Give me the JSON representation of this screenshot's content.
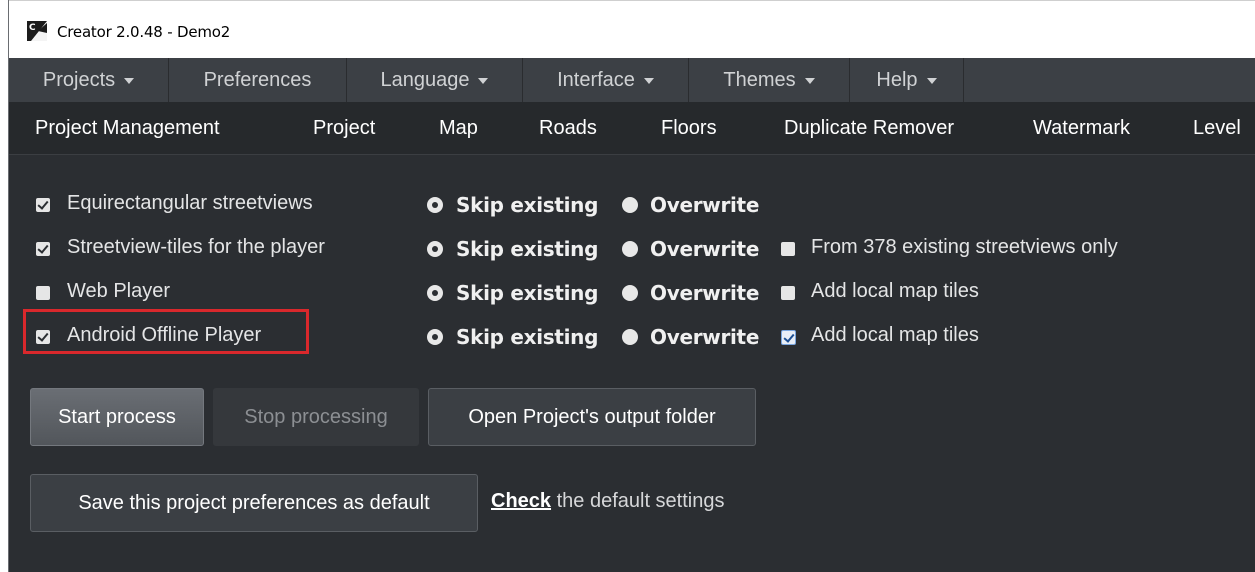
{
  "window": {
    "title": "Creator 2.0.48 - Demo2"
  },
  "menu": {
    "items": [
      {
        "label": "Projects",
        "dropdown": true
      },
      {
        "label": "Preferences",
        "dropdown": false
      },
      {
        "label": "Language",
        "dropdown": true
      },
      {
        "label": "Interface",
        "dropdown": true
      },
      {
        "label": "Themes",
        "dropdown": true
      },
      {
        "label": "Help",
        "dropdown": true
      }
    ]
  },
  "tabs": [
    "Project Management",
    "Project",
    "Map",
    "Roads",
    "Floors",
    "Duplicate Remover",
    "Watermark",
    "Level"
  ],
  "options": [
    {
      "label": "Equirectangular streetviews",
      "checked": true,
      "mode": "Skip existing",
      "radio": [
        "Skip existing",
        "Overwrite"
      ],
      "extra": null
    },
    {
      "label": "Streetview-tiles for the player",
      "checked": true,
      "mode": "Skip existing",
      "radio": [
        "Skip existing",
        "Overwrite"
      ],
      "extra": {
        "label": "From 378 existing streetviews only",
        "checked": false
      }
    },
    {
      "label": "Web Player",
      "checked": false,
      "mode": "Skip existing",
      "radio": [
        "Skip existing",
        "Overwrite"
      ],
      "extra": {
        "label": "Add local map tiles",
        "checked": false
      }
    },
    {
      "label": "Android Offline Player",
      "checked": true,
      "mode": "Skip existing",
      "radio": [
        "Skip existing",
        "Overwrite"
      ],
      "extra": {
        "label": "Add local map tiles",
        "checked": true
      }
    }
  ],
  "buttons": {
    "start": "Start process",
    "stop": "Stop processing",
    "open_output": "Open Project's output folder",
    "save_default": "Save this project preferences as default"
  },
  "check_defaults": {
    "link": "Check",
    "rest": " the default settings"
  },
  "colors": {
    "background": "#2b2e32",
    "menubar": "#3c4045",
    "tabbar": "#26292c",
    "highlight": "#d9282c"
  }
}
